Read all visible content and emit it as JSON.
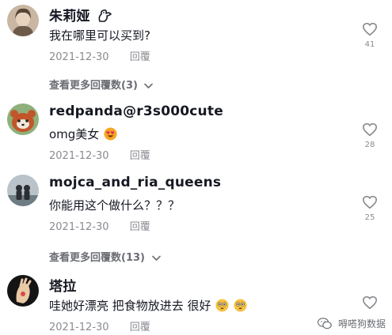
{
  "comments": [
    {
      "username": "朱莉娅",
      "text": "我在哪里可以买到?",
      "date": "2021-12-30",
      "reply_label": "回覆",
      "likes": "41",
      "view_more": "查看更多回覆数",
      "view_more_count": "(3)"
    },
    {
      "username": "redpanda@r3s000cute",
      "text": "omg美女",
      "date": "2021-12-30",
      "reply_label": "回覆",
      "likes": "28"
    },
    {
      "username": "mojca_and_ria_queens",
      "text": "你能用这个做什么？？？",
      "date": "2021-12-30",
      "reply_label": "回覆",
      "likes": "25",
      "view_more": "查看更多回覆数",
      "view_more_count": "(13)"
    },
    {
      "username": "塔拉",
      "text": "哇她好漂亮 把食物放进去 很好",
      "date": "2021-12-30",
      "reply_label": "回覆",
      "likes": ""
    }
  ],
  "watermark": {
    "text": "嘚嗒狗数据"
  },
  "colors": {
    "text": "#161823",
    "muted": "#8a8b91",
    "accent_heart": "#8a8b91"
  }
}
